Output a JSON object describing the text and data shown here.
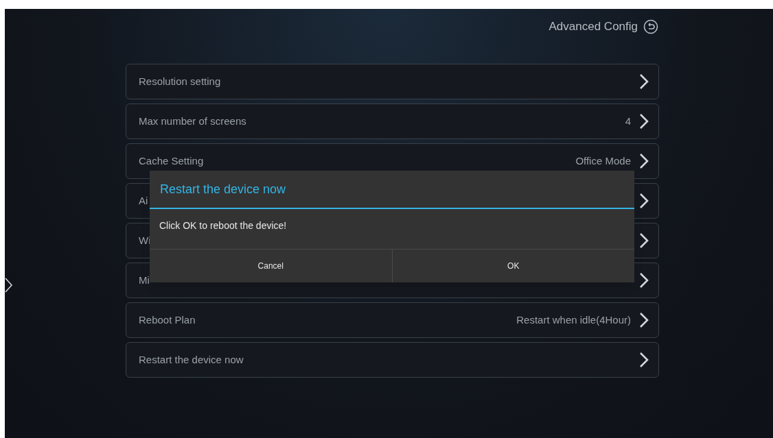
{
  "header": {
    "title": "Advanced Config"
  },
  "settings": [
    {
      "label": "Resolution setting"
    },
    {
      "label": "Max number of screens",
      "value": "4"
    },
    {
      "label": "Cache Setting",
      "value": "Office Mode"
    },
    {
      "label": "Ai"
    },
    {
      "label": "Wi"
    },
    {
      "label": "Mi"
    },
    {
      "label": "Reboot Plan",
      "value": "Restart when idle(4Hour)"
    },
    {
      "label": "Restart the device now"
    }
  ],
  "dialog": {
    "title": "Restart the device now",
    "message": "Click OK to reboot the device!",
    "buttons": [
      "Cancel",
      "OK"
    ]
  }
}
